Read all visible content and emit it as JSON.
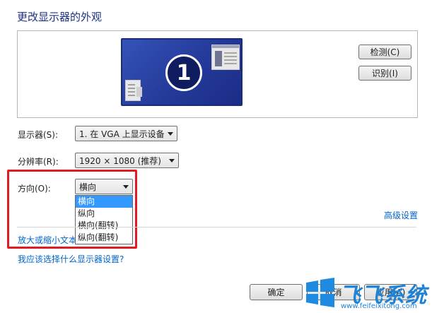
{
  "page": {
    "title": "更改显示器的外观"
  },
  "preview": {
    "monitor_number": "1"
  },
  "buttons": {
    "detect": "检测(C)",
    "identify": "识别(I)",
    "ok": "确定",
    "cancel": "取消",
    "apply": "应用(A)"
  },
  "fields": {
    "display": {
      "label": "显示器(S):",
      "value": "1. 在 VGA 上显示设备"
    },
    "resolution": {
      "label": "分辨率(R):",
      "value": "1920 × 1080 (推荐)"
    },
    "orientation": {
      "label": "方向(O):",
      "value": "横向",
      "options": [
        "横向",
        "纵向",
        "横向(翻转)",
        "纵向(翻转)"
      ],
      "highlighted_option": "横向"
    }
  },
  "links": {
    "advanced": "高级设置",
    "text_size": "放大或缩小文本",
    "help": "我应该选择什么显示器设置?"
  },
  "watermark": {
    "name": "飞飞系统",
    "url": "www.feifeixitong.com"
  },
  "colors": {
    "highlight_border": "#e01b22",
    "selection": "#3399ff",
    "link": "#0066cc"
  }
}
